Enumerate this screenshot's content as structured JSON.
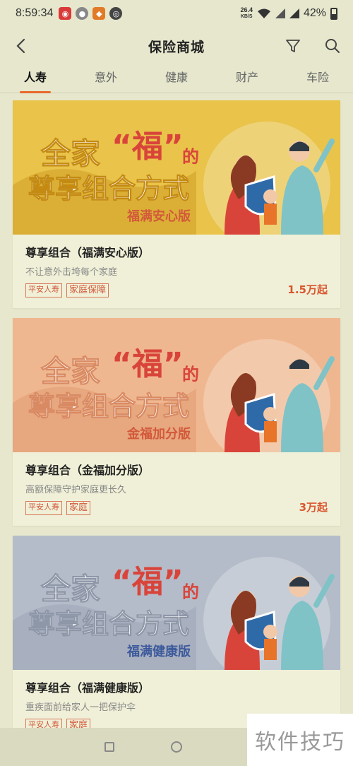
{
  "status_bar": {
    "time": "8:59:34",
    "net_speed_value": "26.4",
    "net_speed_unit": "KB/S",
    "battery": "42%"
  },
  "header": {
    "title": "保险商城"
  },
  "tabs": [
    "人寿",
    "意外",
    "健康",
    "财产",
    "车险"
  ],
  "active_tab_index": 0,
  "banner_text": {
    "line1a": "全家",
    "line1b": "“福”",
    "line1c": "的",
    "line2": "尊享组合方式"
  },
  "products": [
    {
      "banner_edition": "福满安心版",
      "title": "尊享组合（福满安心版）",
      "desc": "不让意外击垮每个家庭",
      "tags": [
        "平安人寿",
        "家庭保障"
      ],
      "price": "1.5万起",
      "theme": "#e9c34a"
    },
    {
      "banner_edition": "金福加分版",
      "title": "尊享组合（金福加分版）",
      "desc": "高额保障守护家庭更长久",
      "tags": [
        "平安人寿",
        "家庭"
      ],
      "price": "3万起",
      "theme": "#efb790"
    },
    {
      "banner_edition": "福满健康版",
      "title": "尊享组合（福满健康版）",
      "desc": "重疾面前给家人一把保护伞",
      "tags": [
        "平安人寿",
        "家庭"
      ],
      "price": "",
      "theme": "#b5bcc9"
    }
  ],
  "watermark": "软件技巧",
  "colors": {
    "accent": "#e9692c",
    "tag": "#d2593a",
    "price": "#d8562f"
  }
}
